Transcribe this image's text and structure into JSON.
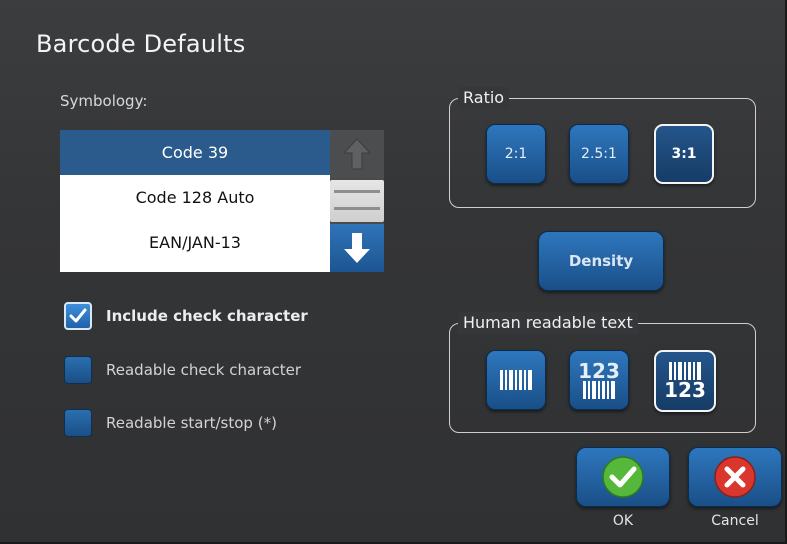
{
  "dialog": {
    "title": "Barcode Defaults"
  },
  "symbology": {
    "label": "Symbology:",
    "items": [
      "Code 39",
      "Code 128 Auto",
      "EAN/JAN-13"
    ],
    "selected": "Code 39"
  },
  "options": {
    "include_check": {
      "label": "Include check character",
      "checked": true
    },
    "readable_check": {
      "label": "Readable check character",
      "checked": false
    },
    "readable_startstop": {
      "label": "Readable start/stop (*)",
      "checked": false
    }
  },
  "ratio": {
    "title": "Ratio",
    "options": [
      "2:1",
      "2.5:1",
      "3:1"
    ],
    "selected": "3:1"
  },
  "density_button": "Density",
  "human_readable": {
    "title": "Human readable text",
    "options": [
      {
        "icon": "barcode-only-icon",
        "text": ""
      },
      {
        "icon": "text-above-barcode-icon",
        "text": "123"
      },
      {
        "icon": "text-below-barcode-icon",
        "text": "123"
      }
    ],
    "selected_index": 2
  },
  "actions": {
    "ok_label": "OK",
    "cancel_label": "Cancel"
  },
  "colors": {
    "accent_blue": "#2e77bd",
    "selection_blue": "#2b5b8c",
    "ok_green": "#56b83a",
    "cancel_red": "#d9362e"
  }
}
